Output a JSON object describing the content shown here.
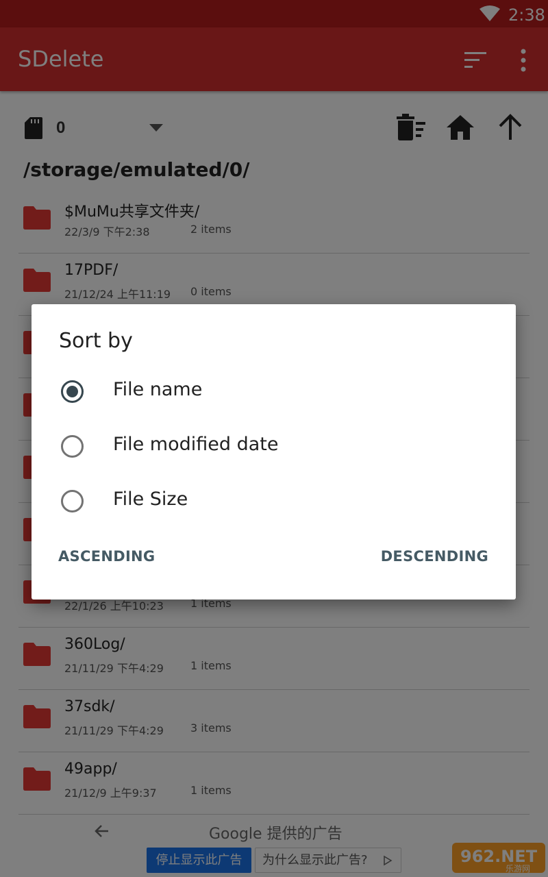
{
  "status_bar": {
    "time": "2:38",
    "wifi_icon": "wifi-icon"
  },
  "app_bar": {
    "title": "SDelete",
    "sort_icon": "sort-icon",
    "more_icon": "more-vert-icon"
  },
  "toolbar": {
    "volume": "0",
    "icons": [
      "sd-card-icon",
      "dropdown-arrow-icon",
      "clean-list-icon",
      "home-icon",
      "arrow-up-icon"
    ]
  },
  "path": "/storage/emulated/0/",
  "files": [
    {
      "name": "$MuMu共享文件夹/",
      "date": "22/3/9  下午2:38",
      "count": "2 items"
    },
    {
      "name": "17PDF/",
      "date": "21/12/24  上午11:19",
      "count": "0 items"
    },
    {
      "name": "",
      "date": "",
      "count": ""
    },
    {
      "name": "",
      "date": "",
      "count": ""
    },
    {
      "name": "",
      "date": "",
      "count": ""
    },
    {
      "name": "",
      "date": "",
      "count": ""
    },
    {
      "name": "",
      "date": "22/1/26  上午10:23",
      "count": "1 items"
    },
    {
      "name": "360Log/",
      "date": "21/11/29  下午4:29",
      "count": "1 items"
    },
    {
      "name": "37sdk/",
      "date": "21/11/29  下午4:29",
      "count": "3 items"
    },
    {
      "name": "49app/",
      "date": "21/12/9  上午9:37",
      "count": "1 items"
    }
  ],
  "ad": {
    "provider": "Google 提供的广告",
    "stop_label": "停止显示此广告",
    "why_label": "为什么显示此广告?"
  },
  "dialog": {
    "title": "Sort by",
    "options": [
      {
        "label": "File name",
        "selected": true
      },
      {
        "label": "File modified date",
        "selected": false
      },
      {
        "label": "File Size",
        "selected": false
      }
    ],
    "ascending_label": "ASCENDING",
    "descending_label": "DESCENDING"
  },
  "watermark": {
    "text": "962.NET",
    "subtext": "乐游网"
  },
  "colors": {
    "primary": "#d32f2f",
    "primary_dark": "#b71c1c",
    "folder": "#e53935",
    "accent": "#37474f"
  }
}
